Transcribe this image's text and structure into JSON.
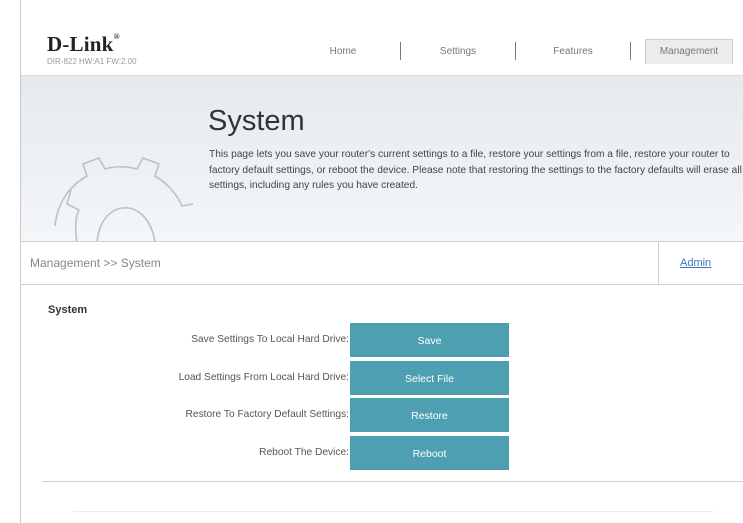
{
  "header": {
    "brand": "D-Link",
    "brand_mark": "®",
    "firmware": "DIR-822 HW:A1 FW:2.00"
  },
  "nav": {
    "items": [
      {
        "label": "Home"
      },
      {
        "label": "Settings"
      },
      {
        "label": "Features"
      },
      {
        "label": "Management"
      }
    ],
    "active": "Management"
  },
  "banner": {
    "title": "System",
    "description": "This page lets you save your router's current settings to a file, restore your settings from a file, restore your router to factory default settings, or reboot the device. Please note that restoring the settings to the factory defaults will erase all settings, including any rules you have created.",
    "icon": "gear-icon"
  },
  "breadcrumb": {
    "text": "Management >> System",
    "admin_link": "Admin"
  },
  "system": {
    "section_title": "System",
    "rows": [
      {
        "label": "Save Settings To Local Hard Drive:",
        "button": "Save"
      },
      {
        "label": "Load Settings From Local Hard Drive:",
        "button": "Select File"
      },
      {
        "label": "Restore To Factory Default Settings:",
        "button": "Restore"
      },
      {
        "label": "Reboot The Device:",
        "button": "Reboot"
      }
    ]
  },
  "colors": {
    "button": "#4e9fb1",
    "link": "#3a7bbd",
    "banner": "#e9edf1"
  }
}
